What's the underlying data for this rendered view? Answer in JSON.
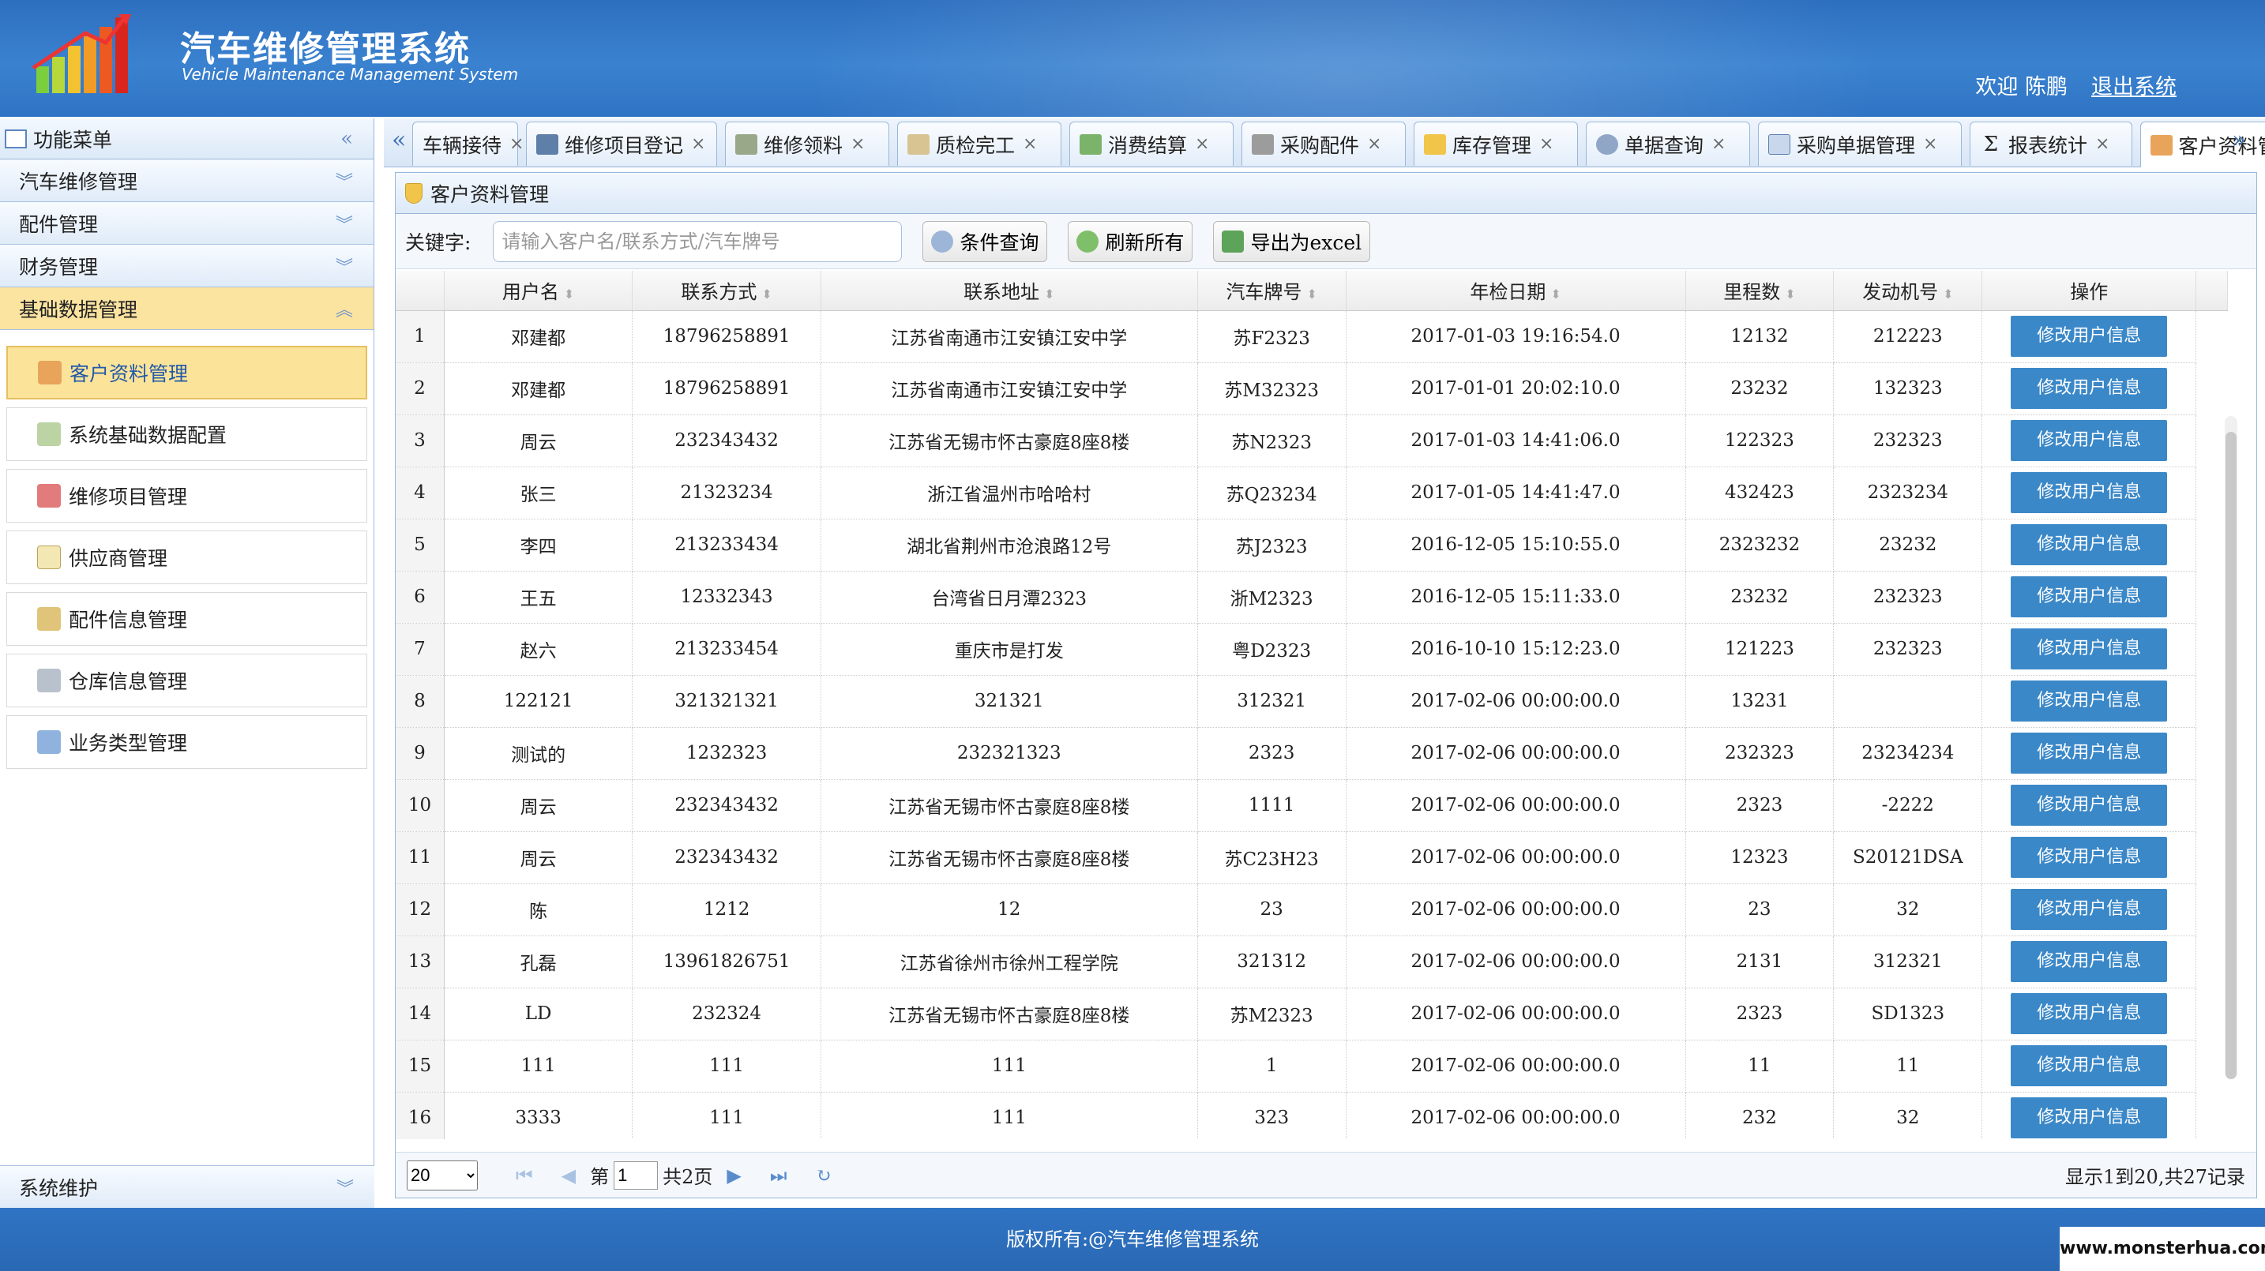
{
  "header": {
    "title": "汽车维修管理系统",
    "subtitle": "Vehicle Maintenance Management System",
    "welcome": "欢迎 陈鹏",
    "logout": "退出系统"
  },
  "sidebar": {
    "title": "功能菜单",
    "sections": [
      "汽车维修管理",
      "配件管理",
      "财务管理",
      "基础数据管理"
    ],
    "active_section": "基础数据管理",
    "items": [
      {
        "label": "客户资料管理",
        "icon": "customer-icon"
      },
      {
        "label": "系统基础数据配置",
        "icon": "tag-icon"
      },
      {
        "label": "维修项目管理",
        "icon": "repair-icon"
      },
      {
        "label": "供应商管理",
        "icon": "document-icon"
      },
      {
        "label": "配件信息管理",
        "icon": "parts-icon"
      },
      {
        "label": "仓库信息管理",
        "icon": "warehouse-icon"
      },
      {
        "label": "业务类型管理",
        "icon": "wrench-icon"
      }
    ],
    "footer_section": "系统维护"
  },
  "tabs": [
    {
      "label": "车辆接待",
      "icon": "car-icon"
    },
    {
      "label": "维修项目登记",
      "icon": "car-register-icon"
    },
    {
      "label": "维修领料",
      "icon": "material-icon"
    },
    {
      "label": "质检完工",
      "icon": "inspect-icon"
    },
    {
      "label": "消费结算",
      "icon": "money-icon"
    },
    {
      "label": "采购配件",
      "icon": "cart-icon"
    },
    {
      "label": "库存管理",
      "icon": "shield-icon"
    },
    {
      "label": "单据查询",
      "icon": "search-icon"
    },
    {
      "label": "采购单据管理",
      "icon": "form-icon"
    },
    {
      "label": "报表统计",
      "icon": "sigma-icon"
    },
    {
      "label": "客户资料管理",
      "icon": "customer-icon"
    }
  ],
  "panel": {
    "title": "客户资料管理",
    "keyword_label": "关键字:",
    "search_placeholder": "请输入客户名/联系方式/汽车牌号",
    "btn_search": "条件查询",
    "btn_refresh": "刷新所有",
    "btn_export": "导出为excel"
  },
  "table": {
    "columns": [
      "用户名",
      "联系方式",
      "联系地址",
      "汽车牌号",
      "年检日期",
      "里程数",
      "发动机号",
      "操作"
    ],
    "action_label": "修改用户信息",
    "rows": [
      [
        "1",
        "邓建都",
        "18796258891",
        "江苏省南通市江安镇江安中学",
        "苏F2323",
        "2017-01-03 19:16:54.0",
        "12132",
        "212223"
      ],
      [
        "2",
        "邓建都",
        "18796258891",
        "江苏省南通市江安镇江安中学",
        "苏M32323",
        "2017-01-01 20:02:10.0",
        "23232",
        "132323"
      ],
      [
        "3",
        "周云",
        "232343432",
        "江苏省无锡市怀古豪庭8座8楼",
        "苏N2323",
        "2017-01-03 14:41:06.0",
        "122323",
        "232323"
      ],
      [
        "4",
        "张三",
        "21323234",
        "浙江省温州市哈哈村",
        "苏Q23234",
        "2017-01-05 14:41:47.0",
        "432423",
        "2323234"
      ],
      [
        "5",
        "李四",
        "213233434",
        "湖北省荆州市沧浪路12号",
        "苏J2323",
        "2016-12-05 15:10:55.0",
        "2323232",
        "23232"
      ],
      [
        "6",
        "王五",
        "12332343",
        "台湾省日月潭2323",
        "浙M2323",
        "2016-12-05 15:11:33.0",
        "23232",
        "232323"
      ],
      [
        "7",
        "赵六",
        "213233454",
        "重庆市是打发",
        "粤D2323",
        "2016-10-10 15:12:23.0",
        "121223",
        "232323"
      ],
      [
        "8",
        "122121",
        "321321321",
        "321321",
        "312321",
        "2017-02-06 00:00:00.0",
        "13231",
        ""
      ],
      [
        "9",
        "测试的",
        "1232323",
        "232321323",
        "2323",
        "2017-02-06 00:00:00.0",
        "232323",
        "23234234"
      ],
      [
        "10",
        "周云",
        "232343432",
        "江苏省无锡市怀古豪庭8座8楼",
        "1111",
        "2017-02-06 00:00:00.0",
        "2323",
        "-2222"
      ],
      [
        "11",
        "周云",
        "232343432",
        "江苏省无锡市怀古豪庭8座8楼",
        "苏C23H23",
        "2017-02-06 00:00:00.0",
        "12323",
        "S20121DSA"
      ],
      [
        "12",
        "陈",
        "1212",
        "12",
        "23",
        "2017-02-06 00:00:00.0",
        "23",
        "32"
      ],
      [
        "13",
        "孔磊",
        "13961826751",
        "江苏省徐州市徐州工程学院",
        "321312",
        "2017-02-06 00:00:00.0",
        "2131",
        "312321"
      ],
      [
        "14",
        "LD",
        "232324",
        "江苏省无锡市怀古豪庭8座8楼",
        "苏M2323",
        "2017-02-06 00:00:00.0",
        "2323",
        "SD1323"
      ],
      [
        "15",
        "111",
        "111",
        "111",
        "1",
        "2017-02-06 00:00:00.0",
        "11",
        "11"
      ],
      [
        "16",
        "3333",
        "111",
        "111",
        "323",
        "2017-02-06 00:00:00.0",
        "232",
        "32"
      ]
    ]
  },
  "pager": {
    "page_size": "20",
    "page_prefix": "第",
    "current_page": "1",
    "page_total": "共2页",
    "summary": "显示1到20,共27记录"
  },
  "footer": {
    "copyright": "版权所有:@汽车维修管理系统",
    "watermark": "www.monsterhua.com"
  },
  "colors": {
    "header_blue": "#3a82d0",
    "active_yellow": "#fbe49a",
    "action_button": "#3b88c8"
  }
}
